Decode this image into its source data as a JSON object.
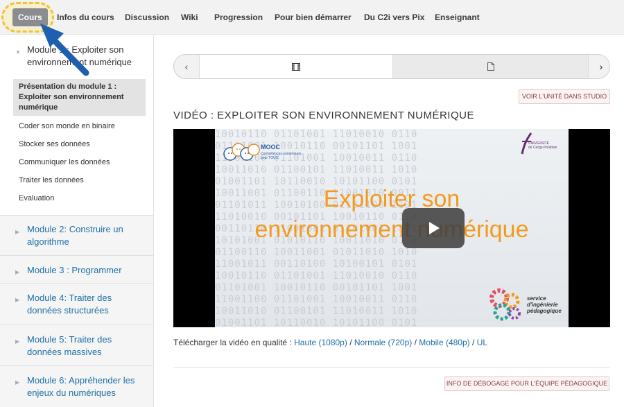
{
  "topnav": {
    "tabs": [
      {
        "label": "Cours",
        "active": true
      },
      {
        "label": "Infos du cours"
      },
      {
        "label": "Discussion"
      },
      {
        "label": "Wiki"
      },
      {
        "label": "Progression"
      },
      {
        "label": "Pour bien démarrer"
      },
      {
        "label": "Du C2i vers Pix"
      },
      {
        "label": "Enseignant"
      }
    ]
  },
  "sidebar": {
    "open_module": {
      "title": "Module 1 : Exploiter son environnement numérique",
      "items": [
        {
          "label": "Présentation du module 1 : Exploiter son environnement numérique",
          "active": true
        },
        {
          "label": "Coder son monde en binaire"
        },
        {
          "label": "Stocker ses données"
        },
        {
          "label": "Communiquer les données"
        },
        {
          "label": "Traiter les données"
        },
        {
          "label": "Evaluation"
        }
      ]
    },
    "modules": [
      {
        "title": "Module 2: Construire un algorithme"
      },
      {
        "title": "Module 3 : Programmer"
      },
      {
        "title": "Module 4: Traiter des données structurées"
      },
      {
        "title": "Module 5: Traiter des données massives"
      },
      {
        "title": "Module 6: Appréhender les enjeux du numériques"
      }
    ]
  },
  "main": {
    "studio_button": "VOIR L'UNITÉ DANS STUDIO",
    "title": "VIDÉO : EXPLOITER SON ENVIRONNEMENT NUMÉRIQUE",
    "video": {
      "slide_title_line1": "Exploiter son",
      "slide_title_line2": "environnement numérique",
      "mooc_logo": "MOOC",
      "mooc_sub1": "Compétences numériques",
      "mooc_sub2": "pour TOUS",
      "univ1": "UNIVERSITÉ",
      "univ2": "de Cergy-Pontoise",
      "service1": "service",
      "service2": "d'ingénierie",
      "service3": "pédagogique"
    },
    "download": {
      "prefix": "Télécharger la vidéo en qualité :",
      "high": "Haute (1080p)",
      "normal": "Normale (720p)",
      "mobile": "Mobile (480p)",
      "ul": "UL",
      "sep": "/"
    },
    "debug_button": "INFO DE DÉBOGAGE POUR L'ÉQUIPE PÉDAGOGIQUE"
  },
  "colors": {
    "link": "#1e6fa5",
    "accent_orange": "#f39a1e",
    "highlight_yellow": "#f2c230",
    "arrow_blue": "#1f5fb0"
  }
}
